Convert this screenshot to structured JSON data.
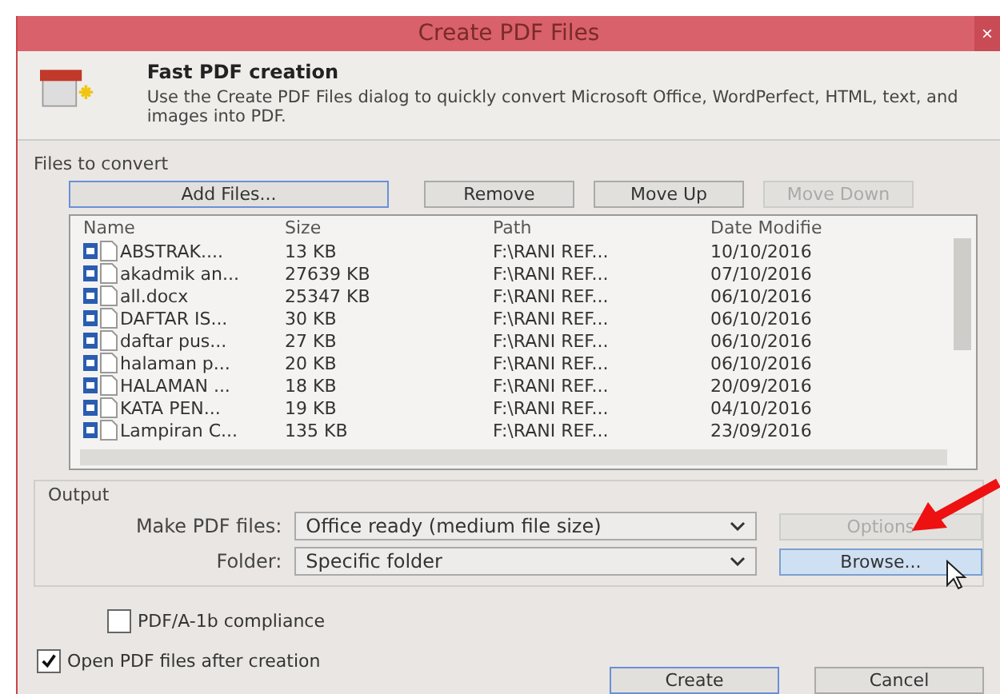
{
  "window": {
    "title": "Create PDF Files",
    "close": "×"
  },
  "header": {
    "title": "Fast PDF creation",
    "description": "Use the Create PDF Files dialog to quickly convert Microsoft Office, WordPerfect, HTML, text, and images into PDF."
  },
  "files": {
    "label": "Files to convert",
    "buttons": [
      {
        "label": "Add Files...",
        "disabled": false,
        "focused": true
      },
      {
        "label": "Remove",
        "disabled": false,
        "focused": false
      },
      {
        "label": "Move Up",
        "disabled": false,
        "focused": false
      },
      {
        "label": "Move Down",
        "disabled": true,
        "focused": false
      }
    ],
    "columns": [
      "Name",
      "Size",
      "Path",
      "Date Modifie"
    ],
    "rows": [
      {
        "name": "ABSTRAK....",
        "size": "13 KB",
        "path": "F:\\RANI REF...",
        "date": "10/10/2016"
      },
      {
        "name": "akadmik an...",
        "size": "27639 KB",
        "path": "F:\\RANI REF...",
        "date": "07/10/2016"
      },
      {
        "name": "all.docx",
        "size": "25347 KB",
        "path": "F:\\RANI REF...",
        "date": "06/10/2016"
      },
      {
        "name": "DAFTAR IS...",
        "size": "30 KB",
        "path": "F:\\RANI REF...",
        "date": "06/10/2016"
      },
      {
        "name": "daftar pus...",
        "size": "27 KB",
        "path": "F:\\RANI REF...",
        "date": "06/10/2016"
      },
      {
        "name": "halaman p...",
        "size": "20 KB",
        "path": "F:\\RANI REF...",
        "date": "06/10/2016"
      },
      {
        "name": "HALAMAN ...",
        "size": "18 KB",
        "path": "F:\\RANI REF...",
        "date": "20/09/2016"
      },
      {
        "name": "KATA PEN...",
        "size": "19 KB",
        "path": "F:\\RANI REF...",
        "date": "04/10/2016"
      },
      {
        "name": "Lampiran C...",
        "size": "135 KB",
        "path": "F:\\RANI REF...",
        "date": "23/09/2016"
      }
    ]
  },
  "output": {
    "label": "Output",
    "make_label": "Make PDF files:",
    "make_value": "Office ready (medium file size)",
    "folder_label": "Folder:",
    "folder_value": "Specific folder",
    "options_button": {
      "label": "Options",
      "disabled": true
    },
    "browse_button": {
      "label": "Browse...",
      "hovered": true
    }
  },
  "checkboxes": [
    {
      "label": "PDF/A-1b compliance",
      "checked": false
    },
    {
      "label": "Open PDF files after creation",
      "checked": true
    }
  ],
  "actions": [
    {
      "label": "Create",
      "focused": true
    },
    {
      "label": "Cancel",
      "focused": false
    }
  ]
}
